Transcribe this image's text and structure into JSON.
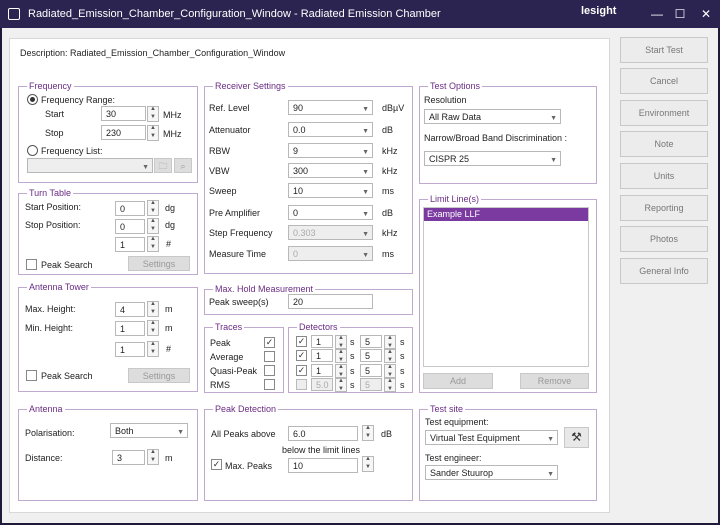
{
  "window": {
    "title": "Radiated_Emission_Chamber_Configuration_Window - Radiated Emission Chamber",
    "logo": "lesight",
    "min": "—",
    "max": "☐",
    "close": "✕"
  },
  "description": "Description: Radiated_Emission_Chamber_Configuration_Window",
  "frequency": {
    "title": "Frequency",
    "range_label": "Frequency Range:",
    "start_label": "Start",
    "start_value": "30",
    "start_unit": "MHz",
    "stop_label": "Stop",
    "stop_value": "230",
    "stop_unit": "MHz",
    "list_label": "Frequency List:"
  },
  "turntable": {
    "title": "Turn Table",
    "start_label": "Start Position:",
    "start_value": "0",
    "start_unit": "dg",
    "stop_label": "Stop Position:",
    "stop_value": "0",
    "stop_unit": "dg",
    "third_value": "1",
    "third_unit": "#",
    "peak_label": "Peak Search",
    "settings": "Settings"
  },
  "tower": {
    "title": "Antenna Tower",
    "max_label": "Max. Height:",
    "max_value": "4",
    "max_unit": "m",
    "min_label": "Min. Height:",
    "min_value": "1",
    "min_unit": "m",
    "third_value": "1",
    "third_unit": "#",
    "peak_label": "Peak Search",
    "settings": "Settings"
  },
  "antenna": {
    "title": "Antenna",
    "pol_label": "Polarisation:",
    "pol_value": "Both",
    "dist_label": "Distance:",
    "dist_value": "3",
    "dist_unit": "m"
  },
  "receiver": {
    "title": "Receiver Settings",
    "rows": [
      {
        "label": "Ref. Level",
        "value": "90",
        "unit": "dBµV"
      },
      {
        "label": "Attenuator",
        "value": "0.0",
        "unit": "dB"
      },
      {
        "label": "RBW",
        "value": "9",
        "unit": "kHz"
      },
      {
        "label": "VBW",
        "value": "300",
        "unit": "kHz"
      },
      {
        "label": "Sweep",
        "value": "10",
        "unit": "ms"
      },
      {
        "label": "Pre Amplifier",
        "value": "0",
        "unit": "dB"
      },
      {
        "label": "Step Frequency",
        "value": "0.303",
        "unit": "kHz"
      },
      {
        "label": "Measure Time",
        "value": "0",
        "unit": "ms"
      }
    ]
  },
  "maxhold": {
    "title": "Max. Hold Measurement",
    "label": "Peak sweep(s)",
    "value": "20"
  },
  "traces": {
    "title": "Traces",
    "items": [
      "Peak",
      "Average",
      "Quasi-Peak",
      "RMS"
    ]
  },
  "detectors": {
    "title": "Detectors",
    "rows": [
      {
        "a": "1",
        "b": "5"
      },
      {
        "a": "1",
        "b": "5"
      },
      {
        "a": "1",
        "b": "5"
      },
      {
        "a": "5.0",
        "b": "5"
      }
    ],
    "unit": "s"
  },
  "peakdet": {
    "title": "Peak Detection",
    "all_label": "All Peaks above",
    "all_value": "6.0",
    "all_unit": "dB",
    "below_label": "below the limit lines",
    "max_label": "Max. Peaks",
    "max_value": "10"
  },
  "testoptions": {
    "title": "Test Options",
    "res_label": "Resolution",
    "res_value": "All Raw Data",
    "disc_label": "Narrow/Broad Band Discrimination :",
    "disc_value": "CISPR 25"
  },
  "limitlines": {
    "title": "Limit Line(s)",
    "items": [
      "Example LLF"
    ],
    "add": "Add",
    "remove": "Remove"
  },
  "testsite": {
    "title": "Test site",
    "eq_label": "Test equipment:",
    "eq_value": "Virtual Test Equipment",
    "eng_label": "Test engineer:",
    "eng_value": "Sander Stuurop"
  },
  "side": [
    "Start Test",
    "Cancel",
    "Environment",
    "Note",
    "Units",
    "Reporting",
    "Photos",
    "General Info"
  ],
  "colors": {
    "accent": "#6a2c85",
    "title_bg": "#2b2350",
    "selection": "#7b3aa0"
  }
}
